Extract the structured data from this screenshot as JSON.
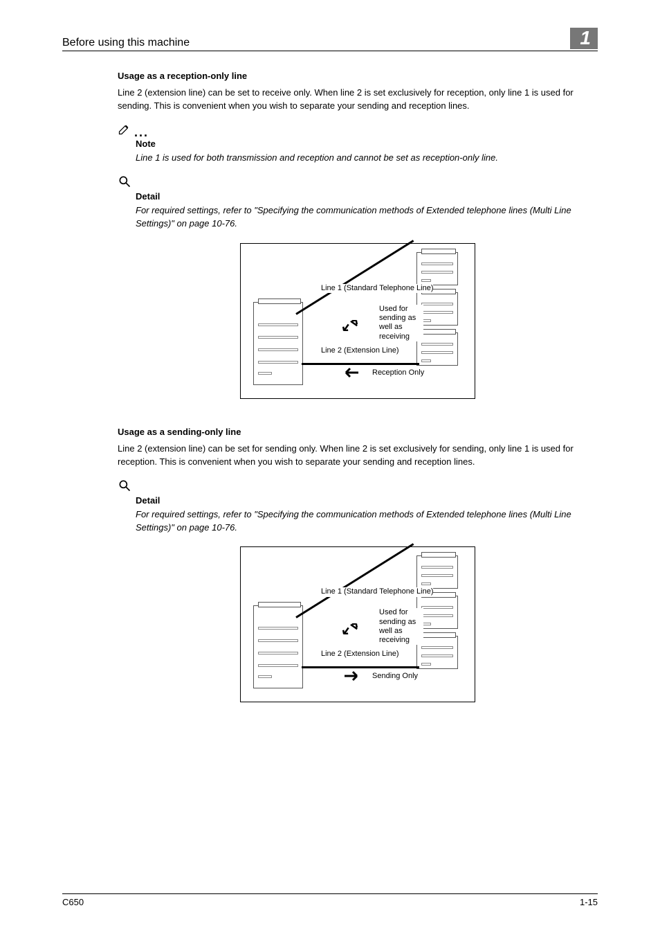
{
  "header": {
    "running_title": "Before using this machine",
    "chapter_number": "1"
  },
  "section1": {
    "heading": "Usage as a reception-only line",
    "body": "Line 2 (extension line) can be set to receive only. When line 2 is set exclusively for reception, only line 1 is used for sending. This is convenient when you wish to separate your sending and reception lines."
  },
  "note": {
    "label": "Note",
    "body": "Line 1 is used for both transmission and reception and cannot be set as reception-only line."
  },
  "detail1": {
    "label": "Detail",
    "body": "For required settings, refer to \"Specifying the communication methods of Extended telephone lines (Multi Line Settings)\" on page 10-76."
  },
  "diagram1": {
    "line1_label": "Line 1 (Standard Telephone Line)",
    "usedfor_label": "Used for sending as well as receiving",
    "line2_label": "Line 2 (Extension Line)",
    "mode_label": "Reception Only"
  },
  "section2": {
    "heading": "Usage as a sending-only line",
    "body": "Line 2 (extension line) can be set for sending only. When line 2 is set exclusively for sending, only line 1 is used for reception. This is convenient when you wish to separate your sending and reception lines."
  },
  "detail2": {
    "label": "Detail",
    "body": "For required settings, refer to \"Specifying the communication methods of Extended telephone lines (Multi Line Settings)\" on page 10-76."
  },
  "diagram2": {
    "line1_label": "Line 1 (Standard Telephone Line)",
    "usedfor_label": "Used for sending as well as receiving",
    "line2_label": "Line 2 (Extension Line)",
    "mode_label": "Sending Only"
  },
  "footer": {
    "model": "C650",
    "page": "1-15"
  }
}
